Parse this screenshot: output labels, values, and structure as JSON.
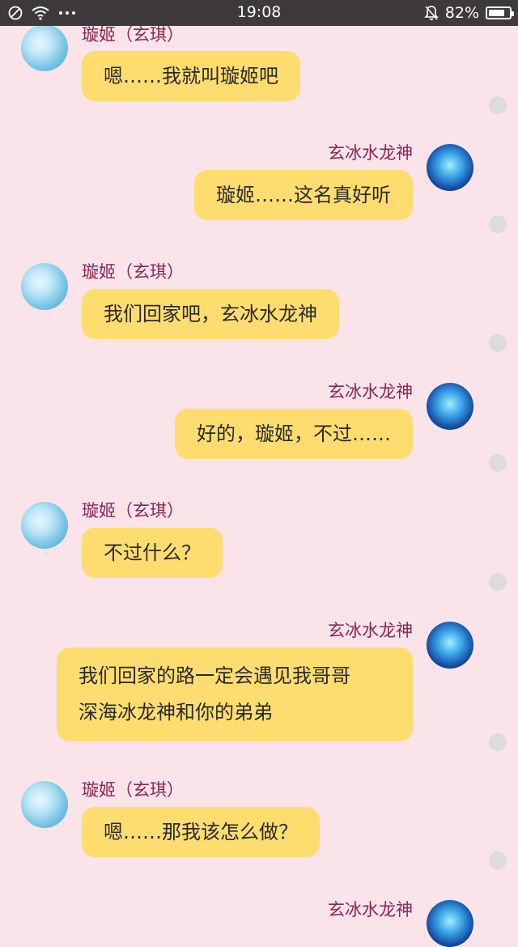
{
  "status_bar": {
    "time": "19:08",
    "battery": "82%",
    "battery_level": 0.82,
    "icons": [
      "dnd-icon",
      "wifi-icon",
      "more-icon",
      "mute-bell-icon",
      "battery-icon"
    ]
  },
  "chat": {
    "messages": [
      {
        "sender": "璇姬（玄琪）",
        "side": "left",
        "text": "嗯……我就叫璇姬吧"
      },
      {
        "sender": "玄冰水龙神",
        "side": "right",
        "text": "璇姬……这名真好听"
      },
      {
        "sender": "璇姬（玄琪）",
        "side": "left",
        "text": "我们回家吧，玄冰水龙神"
      },
      {
        "sender": "玄冰水龙神",
        "side": "right",
        "text": "好的，璇姬，不过……"
      },
      {
        "sender": "璇姬（玄琪）",
        "side": "left",
        "text": "不过什么？"
      },
      {
        "sender": "玄冰水龙神",
        "side": "right",
        "text_lines": [
          "我们回家的路一定会遇见我哥哥",
          "深海冰龙神和你的弟弟"
        ]
      },
      {
        "sender": "璇姬（玄琪）",
        "side": "left",
        "text": "嗯……那我该怎么做？"
      },
      {
        "sender": "玄冰水龙神",
        "side": "right"
      }
    ]
  }
}
